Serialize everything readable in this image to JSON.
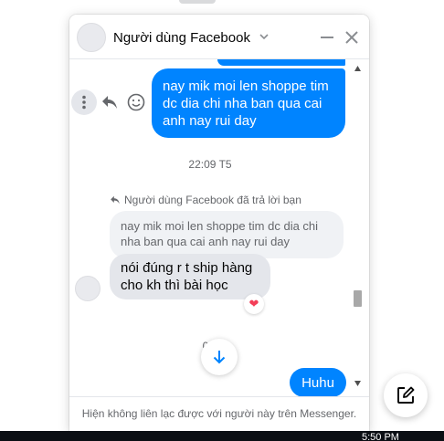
{
  "chat": {
    "title": "Người dùng Facebook",
    "footer_notice": "Hiện không liên lạc được với người này trên Messenger."
  },
  "messages": {
    "outgoing_1": "nay mik moi len shoppe tim dc dia chi nha ban qua cai anh nay rui day",
    "timestamp_1": "22:09 T5",
    "reply_header": "Người dùng Facebook đã trả lời bạn",
    "quoted_text": "nay mik moi len shoppe tim dc dia chi nha ban qua cai anh nay rui day",
    "incoming_1": "nói đúng r t ship hàng cho kh thì bài học",
    "reaction": "❤",
    "timestamp_2": "06:",
    "outgoing_2": "Huhu"
  },
  "taskbar": {
    "clock": "5:50 PM"
  },
  "icons": {
    "header_chevron": "chevron-down-icon",
    "minimize": "minimize-icon",
    "close": "close-icon",
    "more": "more-vertical-icon",
    "reply": "reply-icon",
    "react": "smiley-icon",
    "scroll_down": "arrow-down-icon",
    "compose": "compose-icon"
  },
  "colors": {
    "outgoing_bubble": "#0084ff",
    "incoming_bubble": "#e4e6eb",
    "heart": "#f33e58"
  }
}
